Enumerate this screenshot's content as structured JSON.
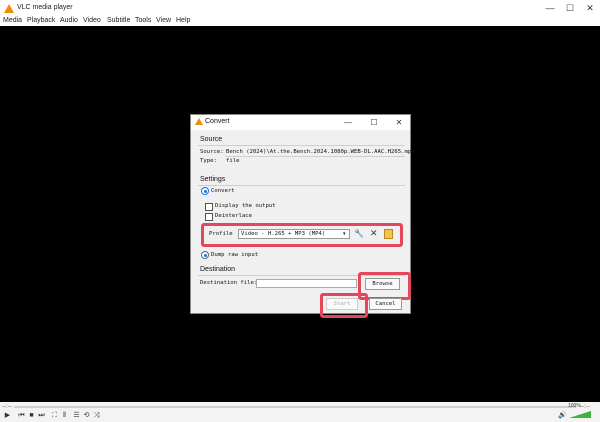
{
  "window": {
    "title": "VLC media player",
    "controls": {
      "minimize": "—",
      "maximize": "☐",
      "close": "✕"
    }
  },
  "menu": [
    "Media",
    "Playback",
    "Audio",
    "Video",
    "Subtitle",
    "Tools",
    "View",
    "Help"
  ],
  "player": {
    "time_elapsed": "--:--",
    "time_total": "--:--",
    "volume": "100%",
    "volume_level": 1.0
  },
  "dialog": {
    "title": "Convert",
    "controls": {
      "minimize": "—",
      "maximize": "☐",
      "close": "✕"
    },
    "source": {
      "heading": "Source",
      "source_label": "Source:",
      "source_value": "Bench (2024)\\At.the.Bench.2024.1080p.WEB-DL.AAC.H265.mp4",
      "type_label": "Type:",
      "type_value": "file"
    },
    "settings": {
      "heading": "Settings",
      "convert_label": "Convert",
      "display_output_label": "Display the output",
      "deinterlace_label": "Deinterlace",
      "profile_label": "Profile",
      "profile_value": "Video - H.265 + MP3 (MP4)",
      "dump_raw_label": "Dump raw input"
    },
    "destination": {
      "heading": "Destination",
      "dest_file_label": "Destination file:",
      "dest_file_value": "",
      "browse_label": "Browse"
    },
    "start_label": "Start",
    "cancel_label": "Cancel"
  },
  "colors": {
    "accent": "#1a73e8",
    "highlight": "#e3485a",
    "vlc_orange": "#f58a07",
    "video_bg": "#000000"
  }
}
